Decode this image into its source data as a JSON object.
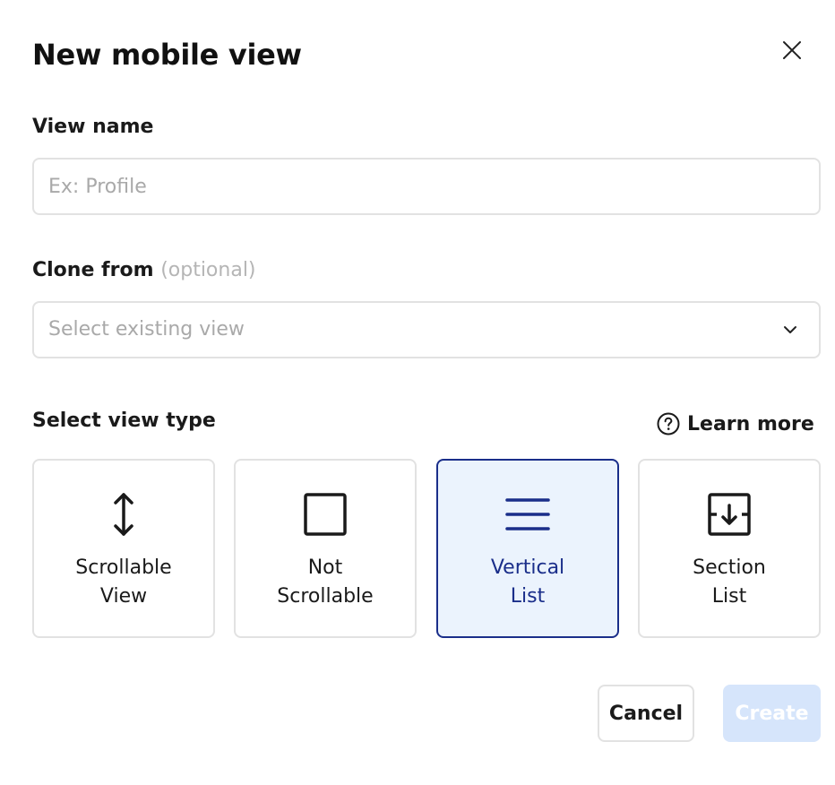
{
  "dialog": {
    "title": "New mobile view"
  },
  "view_name": {
    "label": "View name",
    "placeholder": "Ex: Profile",
    "value": ""
  },
  "clone_from": {
    "label": "Clone from",
    "optional": "(optional)",
    "placeholder": "Select existing view"
  },
  "view_type": {
    "label": "Select view type",
    "learn_more": "Learn more",
    "selected": "vertical-list",
    "options": [
      {
        "id": "scrollable-view",
        "line1": "Scrollable",
        "line2": "View",
        "icon": "vertical-arrows-icon"
      },
      {
        "id": "not-scrollable",
        "line1": "Not",
        "line2": "Scrollable",
        "icon": "square-icon"
      },
      {
        "id": "vertical-list",
        "line1": "Vertical",
        "line2": "List",
        "icon": "hamburger-lines-icon"
      },
      {
        "id": "section-list",
        "line1": "Section",
        "line2": "List",
        "icon": "section-arrow-icon"
      }
    ]
  },
  "footer": {
    "cancel_label": "Cancel",
    "create_label": "Create"
  },
  "colors": {
    "accent": "#1a2e8a",
    "selected_bg": "#ebf3fd",
    "disabled_button": "#d6e5fb",
    "border": "#e2e2e2"
  }
}
